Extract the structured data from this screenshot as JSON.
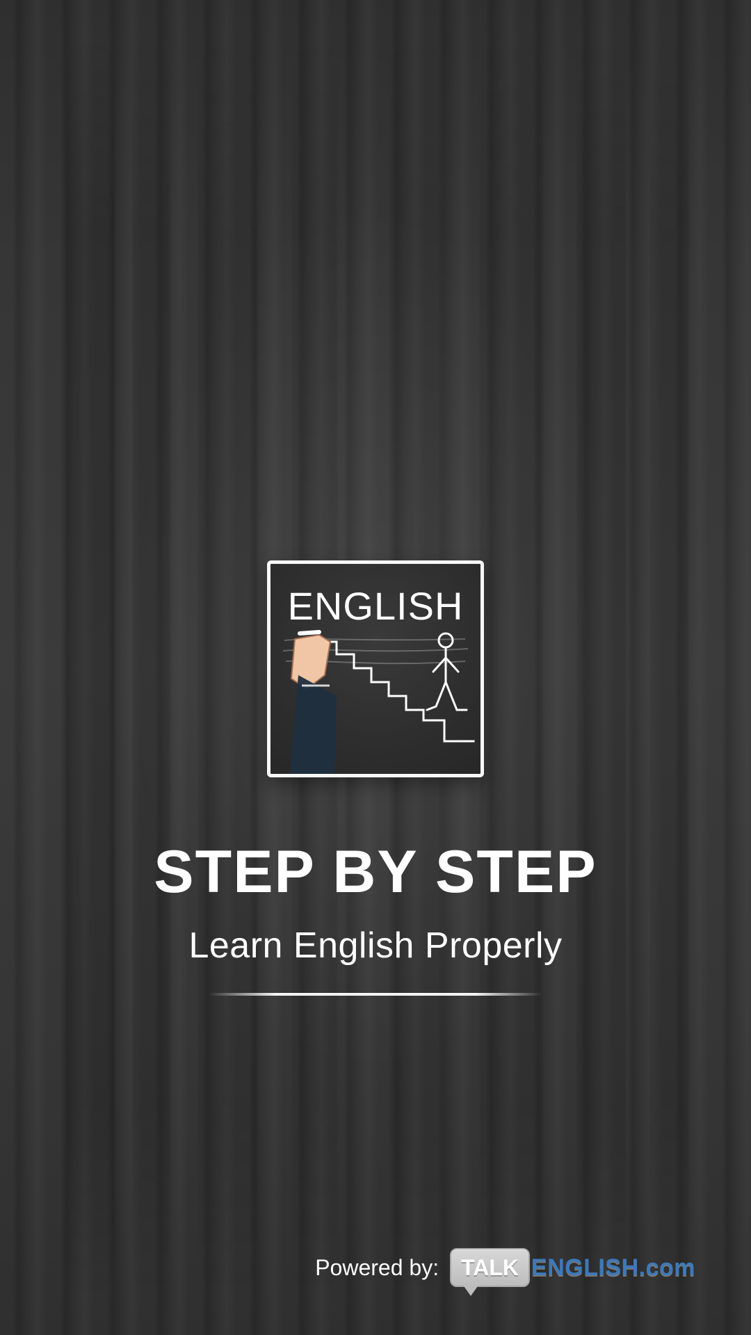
{
  "app": {
    "logo_word": "ENGLISH",
    "title": "STEP BY STEP",
    "subtitle": "Learn English Properly"
  },
  "footer": {
    "powered_label": "Powered by:",
    "brand_badge": "TALK",
    "brand_text": "ENGLISH.com"
  },
  "colors": {
    "background": "#2b2b2b",
    "text": "#ffffff",
    "brand_blue": "#3d79b8",
    "badge_gray": "#c6c6c6"
  },
  "icons": {
    "logo_illustration": "english-steps-illustration-icon",
    "brand_badge": "talk-speech-badge-icon"
  }
}
